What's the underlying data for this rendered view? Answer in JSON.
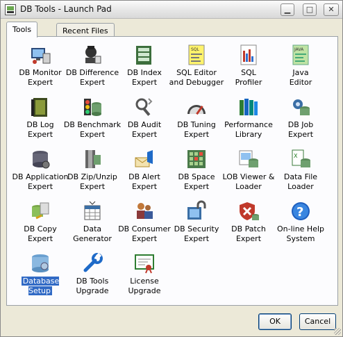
{
  "window": {
    "title": "DB Tools - Launch Pad",
    "minimize_glyph": "▁",
    "maximize_glyph": "□",
    "close_glyph": "✕"
  },
  "tabs": [
    {
      "label": "Tools",
      "active": true
    },
    {
      "label": "Recent Files",
      "active": false
    }
  ],
  "tools": [
    {
      "label": "DB Monitor\nExpert",
      "icon": "monitor-icon"
    },
    {
      "label": "DB Difference\nExpert",
      "icon": "difference-icon"
    },
    {
      "label": "DB Index\nExpert",
      "icon": "index-icon"
    },
    {
      "label": "SQL Editor\nand Debugger",
      "icon": "sql-editor-icon"
    },
    {
      "label": "SQL\nProfiler",
      "icon": "profiler-icon"
    },
    {
      "label": "Java\nEditor",
      "icon": "java-editor-icon"
    },
    {
      "label": "DB Log\nExpert",
      "icon": "log-icon"
    },
    {
      "label": "DB Benchmark\nExpert",
      "icon": "benchmark-icon"
    },
    {
      "label": "DB Audit\nExpert",
      "icon": "audit-icon"
    },
    {
      "label": "DB Tuning\nExpert",
      "icon": "tuning-icon"
    },
    {
      "label": "Performance\nLibrary",
      "icon": "library-icon"
    },
    {
      "label": "DB Job\nExpert",
      "icon": "job-icon"
    },
    {
      "label": "DB Application\nExpert",
      "icon": "application-icon"
    },
    {
      "label": "DB Zip/Unzip\nExpert",
      "icon": "zip-icon"
    },
    {
      "label": "DB Alert\nExpert",
      "icon": "alert-icon"
    },
    {
      "label": "DB Space\nExpert",
      "icon": "space-icon"
    },
    {
      "label": "LOB Viewer &\nLoader",
      "icon": "lob-viewer-icon"
    },
    {
      "label": "Data File\nLoader",
      "icon": "data-file-icon"
    },
    {
      "label": "DB Copy\nExpert",
      "icon": "copy-icon"
    },
    {
      "label": "Data\nGenerator",
      "icon": "generator-icon"
    },
    {
      "label": "DB Consumer\nExpert",
      "icon": "consumer-icon"
    },
    {
      "label": "DB Security\nExpert",
      "icon": "security-icon"
    },
    {
      "label": "DB Patch\nExpert",
      "icon": "patch-icon"
    },
    {
      "label": "On-line Help\nSystem",
      "icon": "help-icon"
    },
    {
      "label": "Database\nSetup",
      "icon": "database-setup-icon",
      "selected": true
    },
    {
      "label": "DB Tools\nUpgrade",
      "icon": "wrench-icon"
    },
    {
      "label": "License\nUpgrade",
      "icon": "certificate-icon"
    }
  ],
  "buttons": {
    "ok": "OK",
    "cancel": "Cancel"
  },
  "colors": {
    "selection": "#316ac5",
    "panel": "#fcfcfe",
    "chrome": "#ece9d8"
  }
}
